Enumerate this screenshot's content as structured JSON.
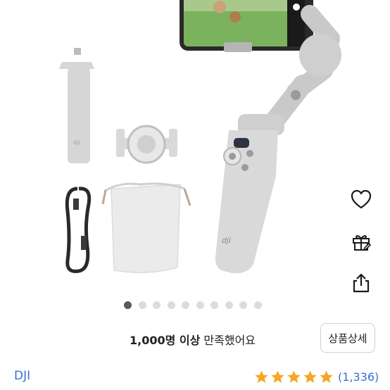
{
  "product": {
    "satisfaction_bold": "1,000명 이상",
    "satisfaction_rest": " 만족했어요",
    "detail_button_label": "상품상세",
    "brand": "DJI",
    "rating_count": "(1,336)",
    "rating_stars": 5
  },
  "gallery": {
    "page_count": 10,
    "active_index": 0
  },
  "side_actions": [
    "heart-icon",
    "gift-icon",
    "share-icon"
  ],
  "colors": {
    "accent_link": "#3b6fd8",
    "star": "#f5a623",
    "dot_active": "#5a5a5a",
    "dot_inactive": "#dcdcdc"
  }
}
